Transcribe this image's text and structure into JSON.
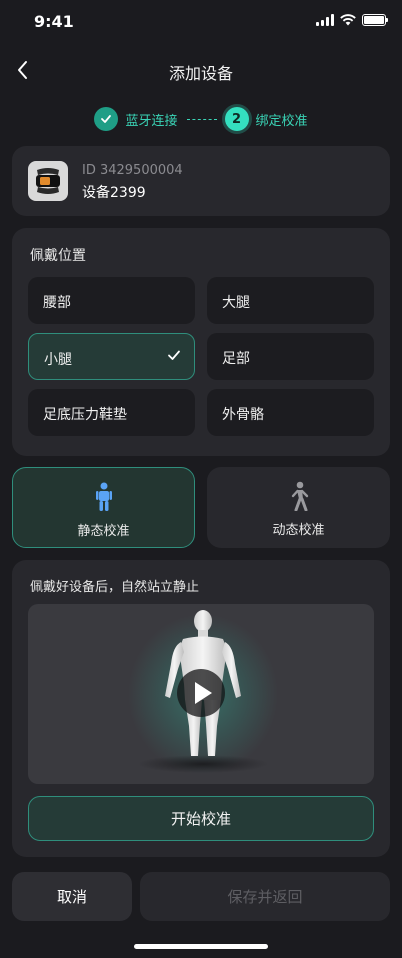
{
  "status_bar": {
    "time": "9:41"
  },
  "nav": {
    "title": "添加设备",
    "back_icon": "chevron-left-icon"
  },
  "stepper": {
    "steps": [
      {
        "label": "蓝牙连接",
        "state": "done",
        "icon": "check-icon"
      },
      {
        "label": "绑定校准",
        "state": "active",
        "number": "2"
      }
    ]
  },
  "device": {
    "id_text": "ID 3429500004",
    "name": "设备2399",
    "icon": "smart-band-icon"
  },
  "wear": {
    "title": "佩戴位置",
    "options": [
      {
        "label": "腰部",
        "selected": false
      },
      {
        "label": "大腿",
        "selected": false
      },
      {
        "label": "小腿",
        "selected": true
      },
      {
        "label": "足部",
        "selected": false
      },
      {
        "label": "足底压力鞋垫",
        "selected": false
      },
      {
        "label": "外骨骼",
        "selected": false
      }
    ]
  },
  "modes": [
    {
      "label": "静态校准",
      "icon": "standing-person-icon",
      "selected": true
    },
    {
      "label": "动态校准",
      "icon": "walking-person-icon",
      "selected": false
    }
  ],
  "calibration": {
    "instruction": "佩戴好设备后，自然站立静止",
    "video_icon": "play-icon",
    "start_label": "开始校准"
  },
  "footer": {
    "cancel_label": "取消",
    "save_label": "保存并返回"
  },
  "colors": {
    "accent": "#34e0c0",
    "accent_dark": "#1f9e86",
    "background": "#1b1b1f",
    "card": "#28282d"
  }
}
